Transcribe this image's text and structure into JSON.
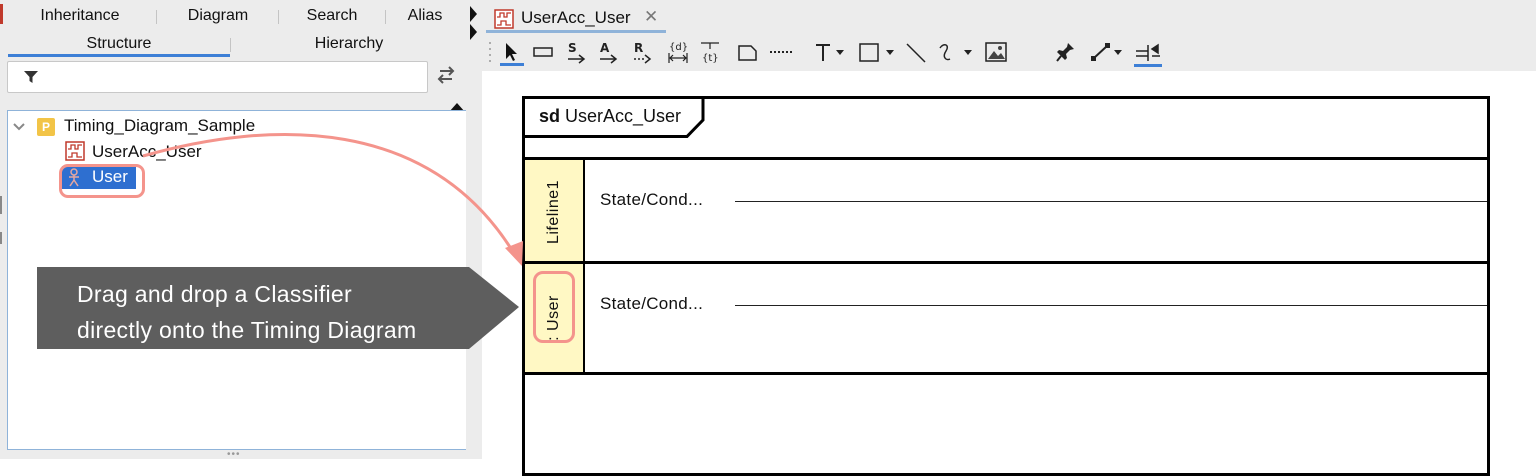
{
  "left_panel": {
    "tabs_row1": [
      "Inheritance",
      "Diagram",
      "Search",
      "Alias"
    ],
    "tabs_row2": [
      "Structure",
      "Hierarchy"
    ],
    "active_tab": "Structure",
    "filter": {
      "value": "",
      "placeholder": ""
    },
    "tree": {
      "package": "Timing_Diagram_Sample",
      "diagram": "UserAcc_User",
      "selected_classifier": "User"
    }
  },
  "editor": {
    "tab_title": "UserAcc_User",
    "tab_close": "✕",
    "toolbar": {
      "tools": [
        "select-tool",
        "rectangle-tool",
        "s-message-tool",
        "a-message-tool",
        "r-message-tool",
        "duration-constraint-tool",
        "time-constraint-tool",
        "note-tool",
        "dashed-line-tool",
        "text-tool",
        "box-tool",
        "line-tool",
        "freehand-tool",
        "image-tool",
        "pin-tool",
        "connector-tool",
        "align-tool"
      ]
    },
    "frame": {
      "keyword": "sd",
      "name": "UserAcc_User"
    },
    "lifelines": [
      {
        "name": "Lifeline1",
        "state_label": "State/Cond..."
      },
      {
        "name": ": User",
        "state_label": "State/Cond..."
      }
    ]
  },
  "callout": {
    "line1": "Drag and drop a Classifier",
    "line2": "directly onto the Timing Diagram"
  },
  "colors": {
    "selection": "#2e6fd0",
    "highlight": "#f4948c",
    "callout_bg": "#5e5e5e",
    "lifeline_header": "#fff8c4",
    "accent": "#3d7fd6"
  }
}
